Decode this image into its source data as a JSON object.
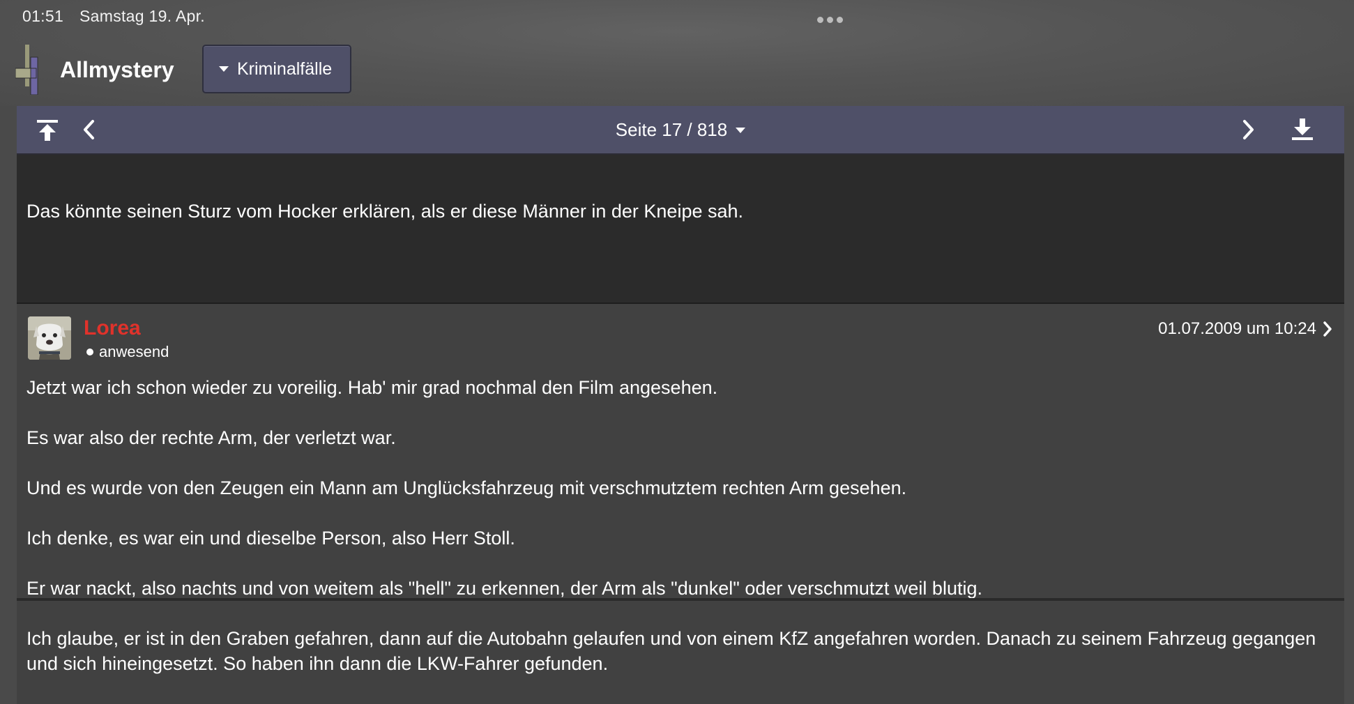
{
  "status_bar": {
    "time": "01:51",
    "date": "Samstag 19. Apr."
  },
  "header": {
    "site_title": "Allmystery",
    "category": "Kriminalfälle"
  },
  "pager": {
    "label": "Seite 17 / 818",
    "current_page": 17,
    "total_pages": 818
  },
  "previous_post": {
    "text": "Das könnte seinen Sturz vom Hocker erklären, als er diese Männer in der Kneipe sah."
  },
  "post": {
    "author": "Lorea",
    "author_color": "#e0322b",
    "status": "anwesend",
    "date": "01.07.2009 um 10:24",
    "paragraphs": [
      "Jetzt war ich schon wieder zu voreilig. Hab' mir grad nochmal den Film angesehen.",
      "Es war also der rechte Arm, der verletzt war.",
      "Und es wurde von den Zeugen ein Mann am Unglücksfahrzeug mit verschmutztem rechten Arm gesehen.",
      "Ich denke, es war ein und dieselbe Person, also Herr Stoll.",
      "Er war nackt, also nachts und von weitem als \"hell\" zu erkennen, der Arm als \"dunkel\" oder verschmutzt weil blutig.",
      "Ich glaube, er ist in den Graben gefahren, dann auf die Autobahn gelaufen und von einem KfZ angefahren worden. Danach zu seinem Fahrzeug gegangen und sich hineingesetzt. So haben ihn dann die LKW-Fahrer gefunden."
    ]
  },
  "icons": {
    "first_page": "arrow-up-to-line-icon",
    "previous_page": "chevron-left-icon",
    "next_page": "chevron-right-icon",
    "last_page": "arrow-down-to-line-icon",
    "post_link": "chevron-right-icon"
  },
  "colors": {
    "nav_bar": "#4f5068",
    "background": "#414141",
    "author_name": "#e0322b"
  }
}
